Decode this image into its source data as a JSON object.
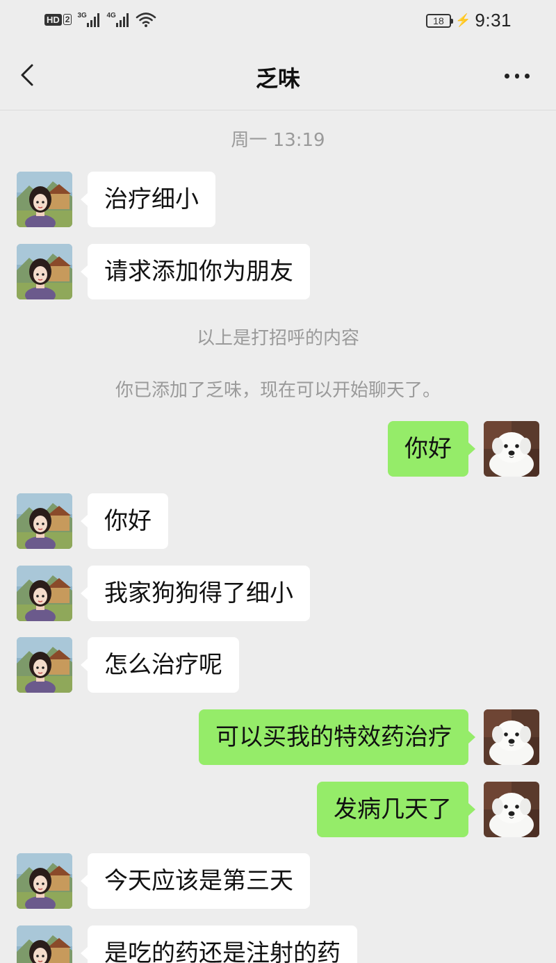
{
  "status_bar": {
    "hd_label": "HD",
    "sim_label": "2",
    "signal1_label": "3G",
    "signal2_label": "4G",
    "battery_level": "18",
    "time": "9:31"
  },
  "nav": {
    "title": "乏味"
  },
  "chat": {
    "timestamp": "周一 13:19",
    "greeting_note": "以上是打招呼的内容",
    "added_note": "你已添加了乏味，现在可以开始聊天了。",
    "messages": [
      {
        "side": "in",
        "text": "治疗细小"
      },
      {
        "side": "in",
        "text": "请求添加你为朋友"
      },
      {
        "side": "out",
        "text": "你好"
      },
      {
        "side": "in",
        "text": "你好"
      },
      {
        "side": "in",
        "text": "我家狗狗得了细小"
      },
      {
        "side": "in",
        "text": "怎么治疗呢"
      },
      {
        "side": "out",
        "text": "可以买我的特效药治疗"
      },
      {
        "side": "out",
        "text": "发病几天了"
      },
      {
        "side": "in",
        "text": "今天应该是第三天"
      },
      {
        "side": "in",
        "text": "是吃的药还是注射的药"
      }
    ]
  },
  "colors": {
    "background": "#ededed",
    "incoming_bubble": "#ffffff",
    "outgoing_bubble": "#95ec69",
    "system_text": "#9a9a9a"
  }
}
